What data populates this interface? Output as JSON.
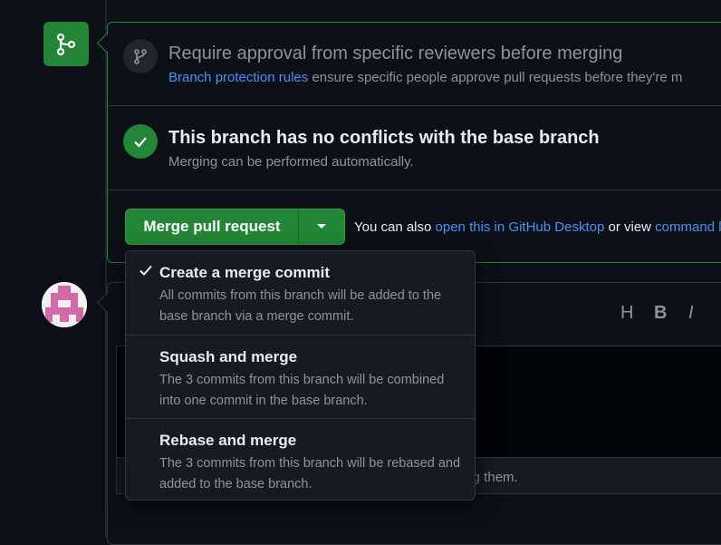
{
  "reviewers": {
    "title": "Require approval from specific reviewers before merging",
    "link": "Branch protection rules",
    "text": " ensure specific people approve pull requests before they're m"
  },
  "conflicts": {
    "title": "This branch has no conflicts with the base branch",
    "subtitle": "Merging can be performed automatically."
  },
  "merge_button": {
    "label": "Merge pull request"
  },
  "also": {
    "prefix": "You can also ",
    "desktop_link": "open this in GitHub Desktop",
    "middle": " or view ",
    "cli_link": "command l"
  },
  "toolbar": {
    "heading": "H",
    "bold": "B",
    "italic": "I"
  },
  "editor": {
    "footer_tail": "ing them."
  },
  "merge_options": [
    {
      "title": "Create a merge commit",
      "description": "All commits from this branch will be added to the base branch via a merge commit.",
      "selected": true
    },
    {
      "title": "Squash and merge",
      "description": "The 3 commits from this branch will be combined into one commit in the base branch.",
      "selected": false
    },
    {
      "title": "Rebase and merge",
      "description": "The 3 commits from this branch will be rebased and added to the base branch.",
      "selected": false
    }
  ],
  "colors": {
    "accent_green": "#238636",
    "link_blue": "#4493f8",
    "bg": "#0d1117"
  }
}
